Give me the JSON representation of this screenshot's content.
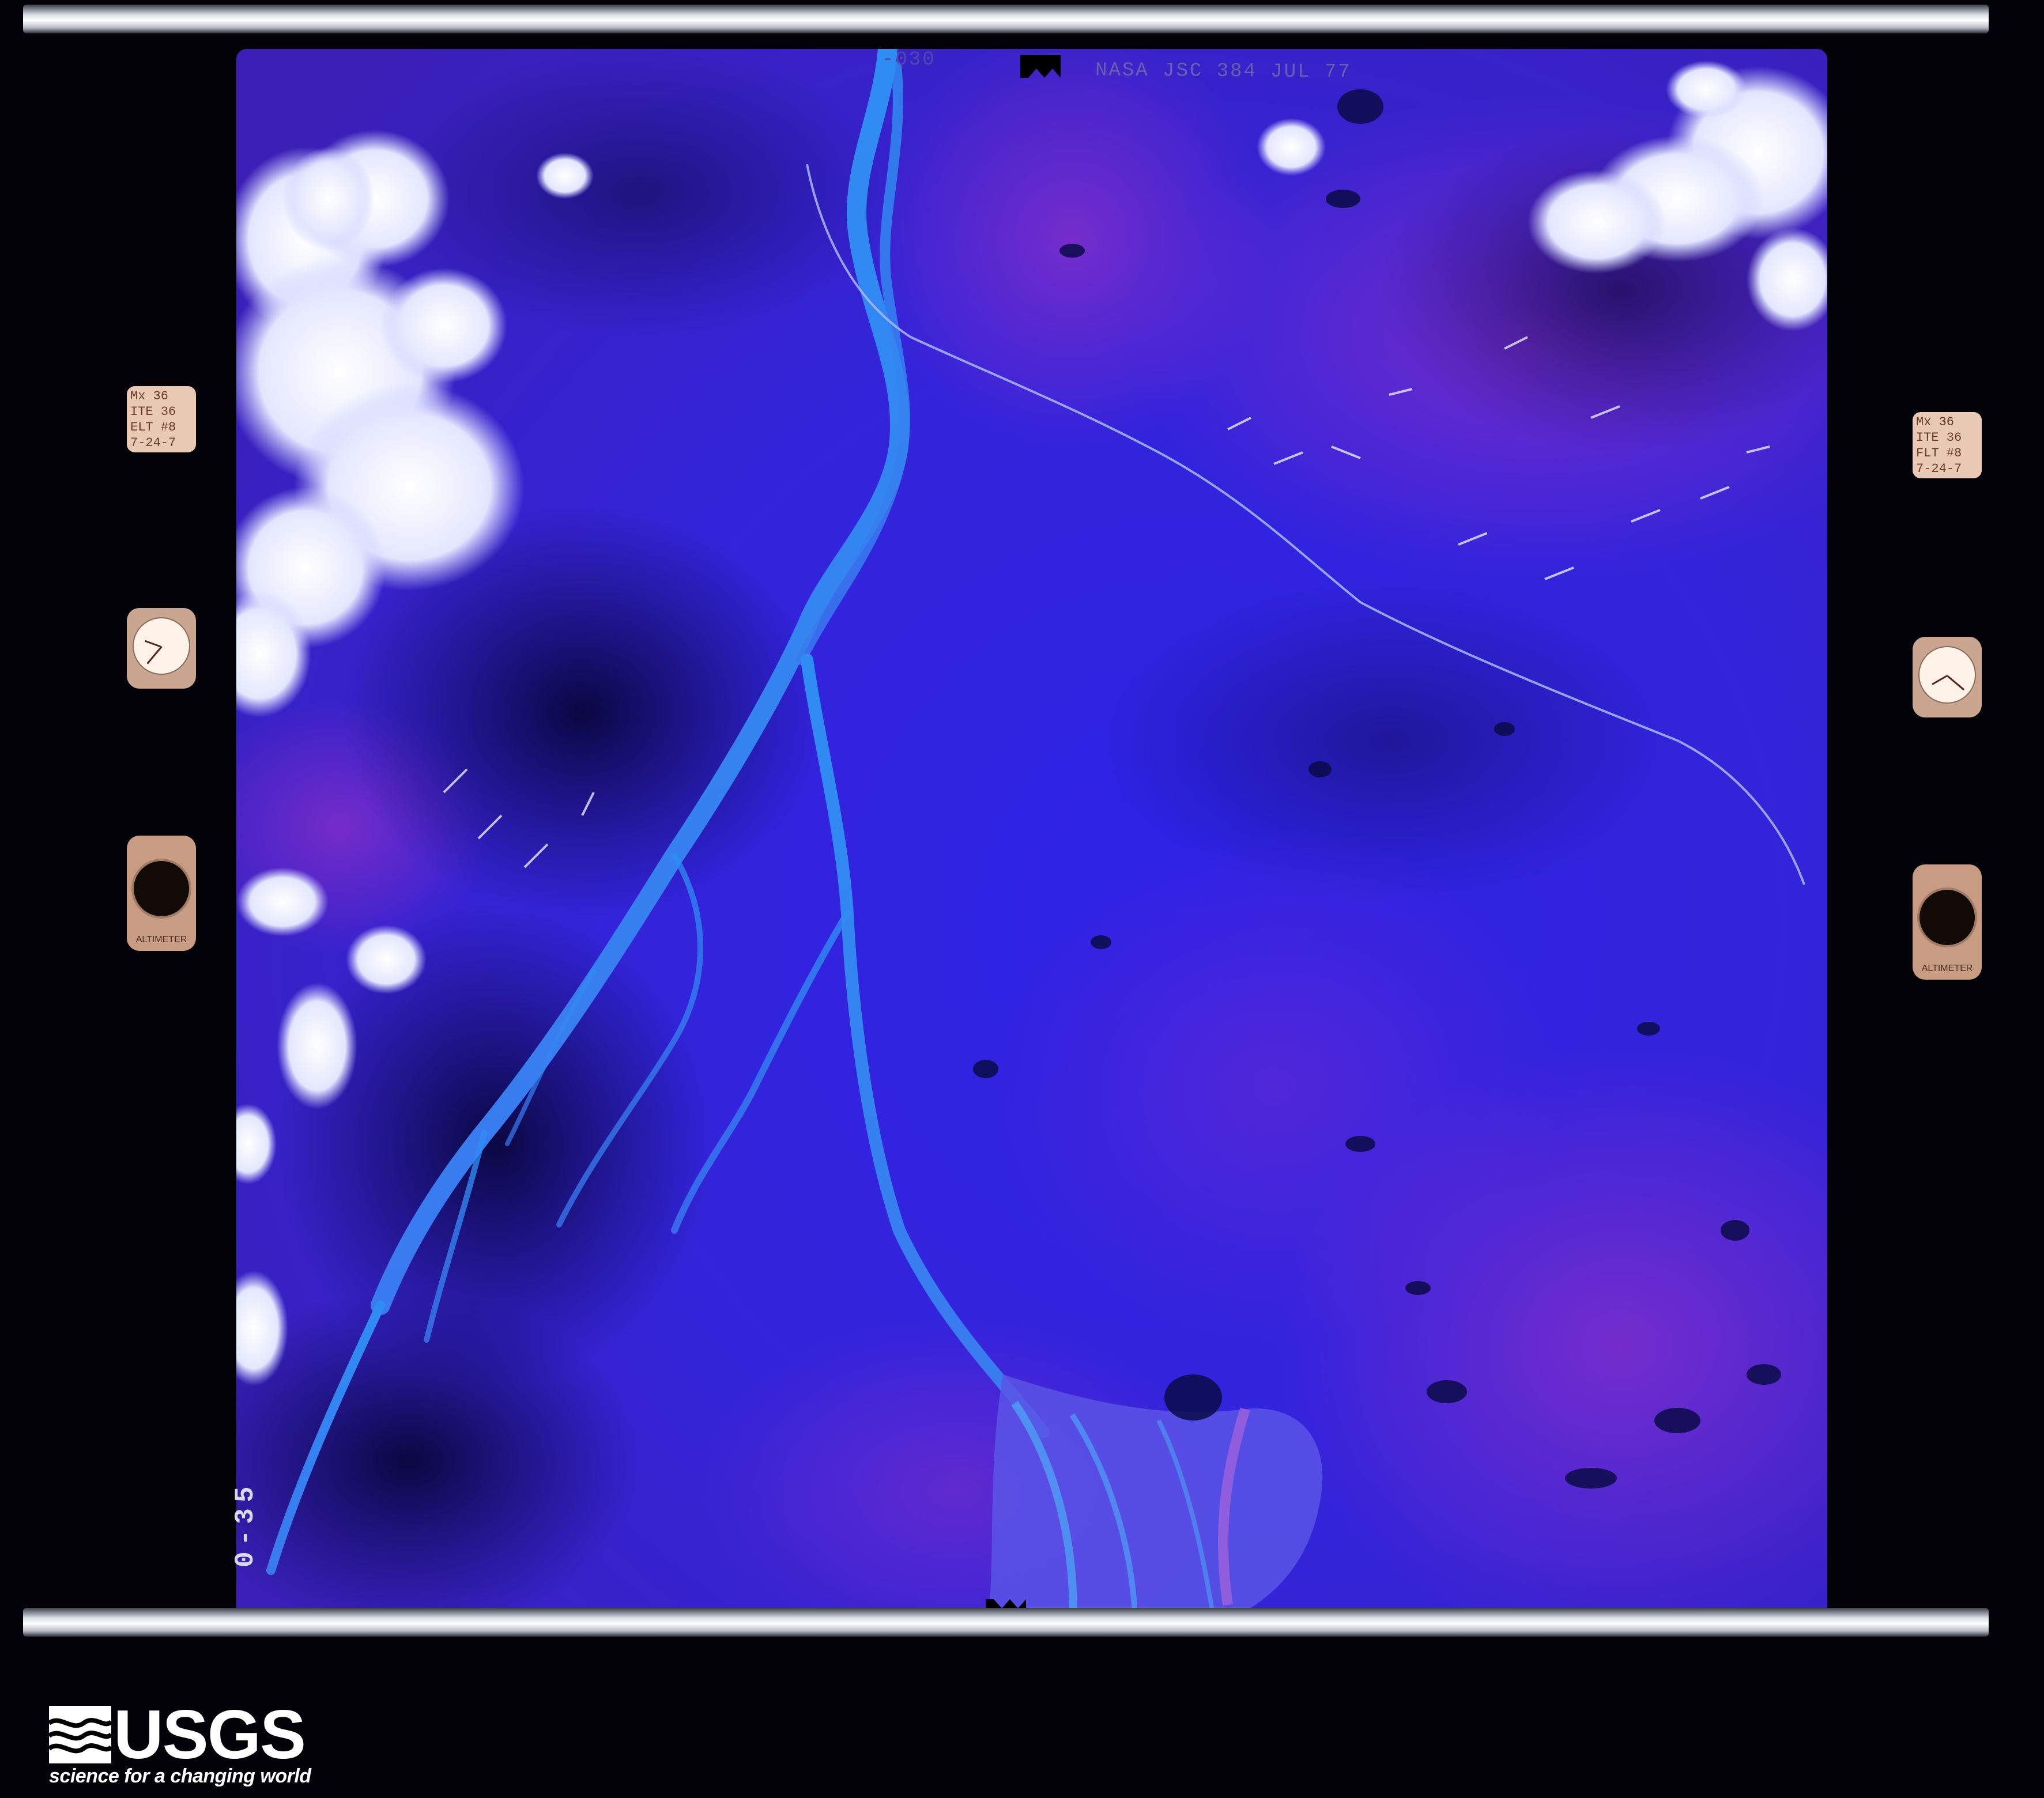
{
  "photo": {
    "frame_header": "NASA JSC 384 JUL 77",
    "frame_id_fragment": "-030",
    "frame_number": "0-35",
    "left_label": "Mx 36\nITE 36\nELT #8\n7-24-7",
    "right_label": "Mx 36\nITE 36\nFLT #8\n7-24-7",
    "gauge_caption": "ALTIMETER"
  },
  "logo": {
    "wordmark": "USGS",
    "tagline": "science for a changing world"
  }
}
